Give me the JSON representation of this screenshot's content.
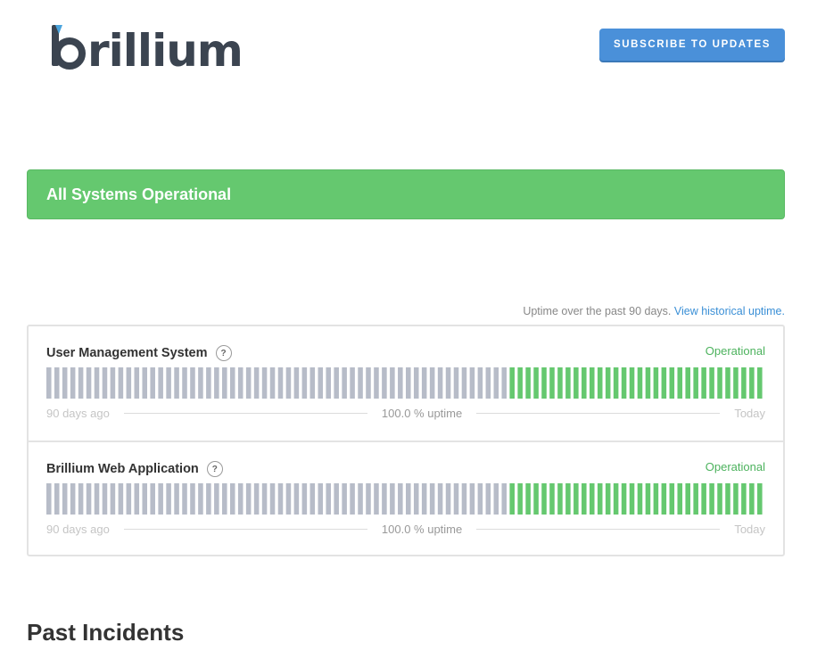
{
  "header": {
    "logo_text": "brillium",
    "subscribe_label": "SUBSCRIBE TO UPDATES"
  },
  "banner": {
    "text": "All Systems Operational",
    "color": "#65c86f"
  },
  "uptime": {
    "note": "Uptime over the past 90 days.",
    "link": "View historical uptime."
  },
  "components": [
    {
      "name": "User Management System",
      "status": "Operational",
      "start_label": "90 days ago",
      "uptime_label": "100.0 % uptime",
      "end_label": "Today",
      "days_total": 90,
      "days_no_data": 58,
      "days_operational": 32
    },
    {
      "name": "Brillium Web Application",
      "status": "Operational",
      "start_label": "90 days ago",
      "uptime_label": "100.0 % uptime",
      "end_label": "Today",
      "days_total": 90,
      "days_no_data": 58,
      "days_operational": 32
    }
  ],
  "colors": {
    "no_data": "#b7bcc8",
    "operational": "#65c86f",
    "accent": "#4a90d9"
  },
  "past_incidents": {
    "title": "Past Incidents"
  }
}
